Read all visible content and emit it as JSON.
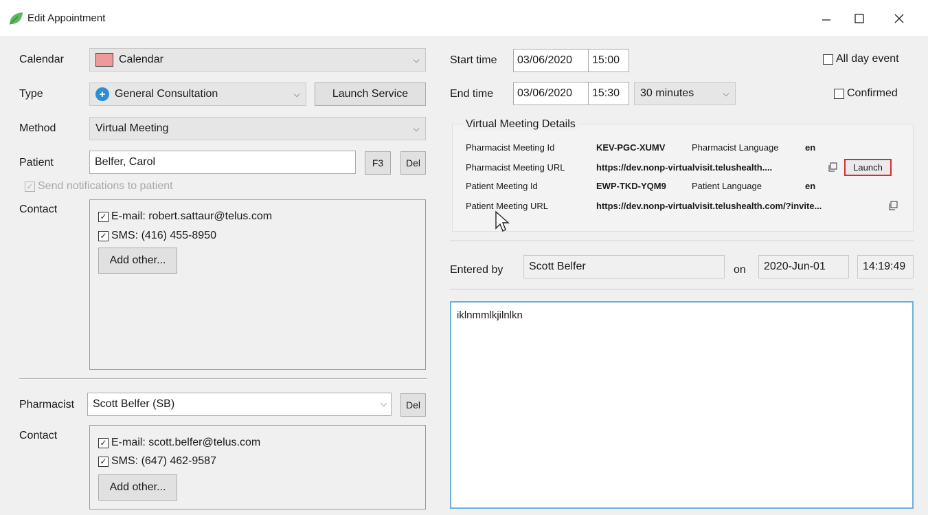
{
  "window": {
    "title": "Edit Appointment"
  },
  "left": {
    "calendar": {
      "label": "Calendar",
      "value": "Calendar",
      "swatch_color": "#ef9a9a"
    },
    "type": {
      "label": "Type",
      "value": "General Consultation",
      "launch_service": "Launch Service"
    },
    "method": {
      "label": "Method",
      "value": "Virtual Meeting"
    },
    "patient": {
      "label": "Patient",
      "value": "Belfer, Carol",
      "f3": "F3",
      "del": "Del"
    },
    "send_notifications": {
      "label": "Send notifications to patient",
      "checked": true,
      "disabled": true
    },
    "patient_contact": {
      "label": "Contact",
      "items": [
        {
          "text": "E-mail: robert.sattaur@telus.com",
          "checked": true
        },
        {
          "text": "SMS: (416) 455-8950",
          "checked": true
        }
      ],
      "add_other": "Add other..."
    },
    "pharmacist": {
      "label": "Pharmacist",
      "value": "Scott Belfer (SB)",
      "del": "Del"
    },
    "pharmacist_contact": {
      "label": "Contact",
      "items": [
        {
          "text": "E-mail: scott.belfer@telus.com",
          "checked": true
        },
        {
          "text": "SMS: (647) 462-9587",
          "checked": true
        }
      ],
      "add_other": "Add other..."
    }
  },
  "right": {
    "start": {
      "label": "Start time",
      "date": "03/06/2020",
      "time": "15:00"
    },
    "end": {
      "label": "End time",
      "date": "03/06/2020",
      "time": "15:30",
      "duration": "30 minutes"
    },
    "all_day": {
      "label": "All day event",
      "checked": false
    },
    "confirmed": {
      "label": "Confirmed",
      "checked": false
    },
    "virtual_meeting": {
      "title": "Virtual Meeting Details",
      "pharmacist_meeting_id_label": "Pharmacist Meeting Id",
      "pharmacist_meeting_id": "KEV-PGC-XUMV",
      "pharmacist_language_label": "Pharmacist Language",
      "pharmacist_language": "en",
      "pharmacist_url_label": "Pharmacist Meeting URL",
      "pharmacist_url": "https://dev.nonp-virtualvisit.telushealth....",
      "launch": "Launch",
      "patient_meeting_id_label": "Patient Meeting Id",
      "patient_meeting_id": "EWP-TKD-YQM9",
      "patient_language_label": "Patient Language",
      "patient_language": "en",
      "patient_url_label": "Patient Meeting URL",
      "patient_url": "https://dev.nonp-virtualvisit.telushealth.com/?invite..."
    },
    "entered": {
      "label": "Entered by",
      "by": "Scott Belfer",
      "on_label": "on",
      "date": "2020-Jun-01",
      "time": "14:19:49"
    },
    "notes": "iklnmmlkjilnlkn"
  },
  "icons": [
    "leaf-app-icon",
    "plus-circle-icon",
    "copy-icon",
    "chevron-down-icon",
    "mouse-pointer-icon"
  ],
  "colors": {
    "accent_blue": "#2a8fd6",
    "focus_border": "#6fb0d6",
    "highlight_red": "#d32f2f",
    "leaf_green": "#5cb85c"
  }
}
